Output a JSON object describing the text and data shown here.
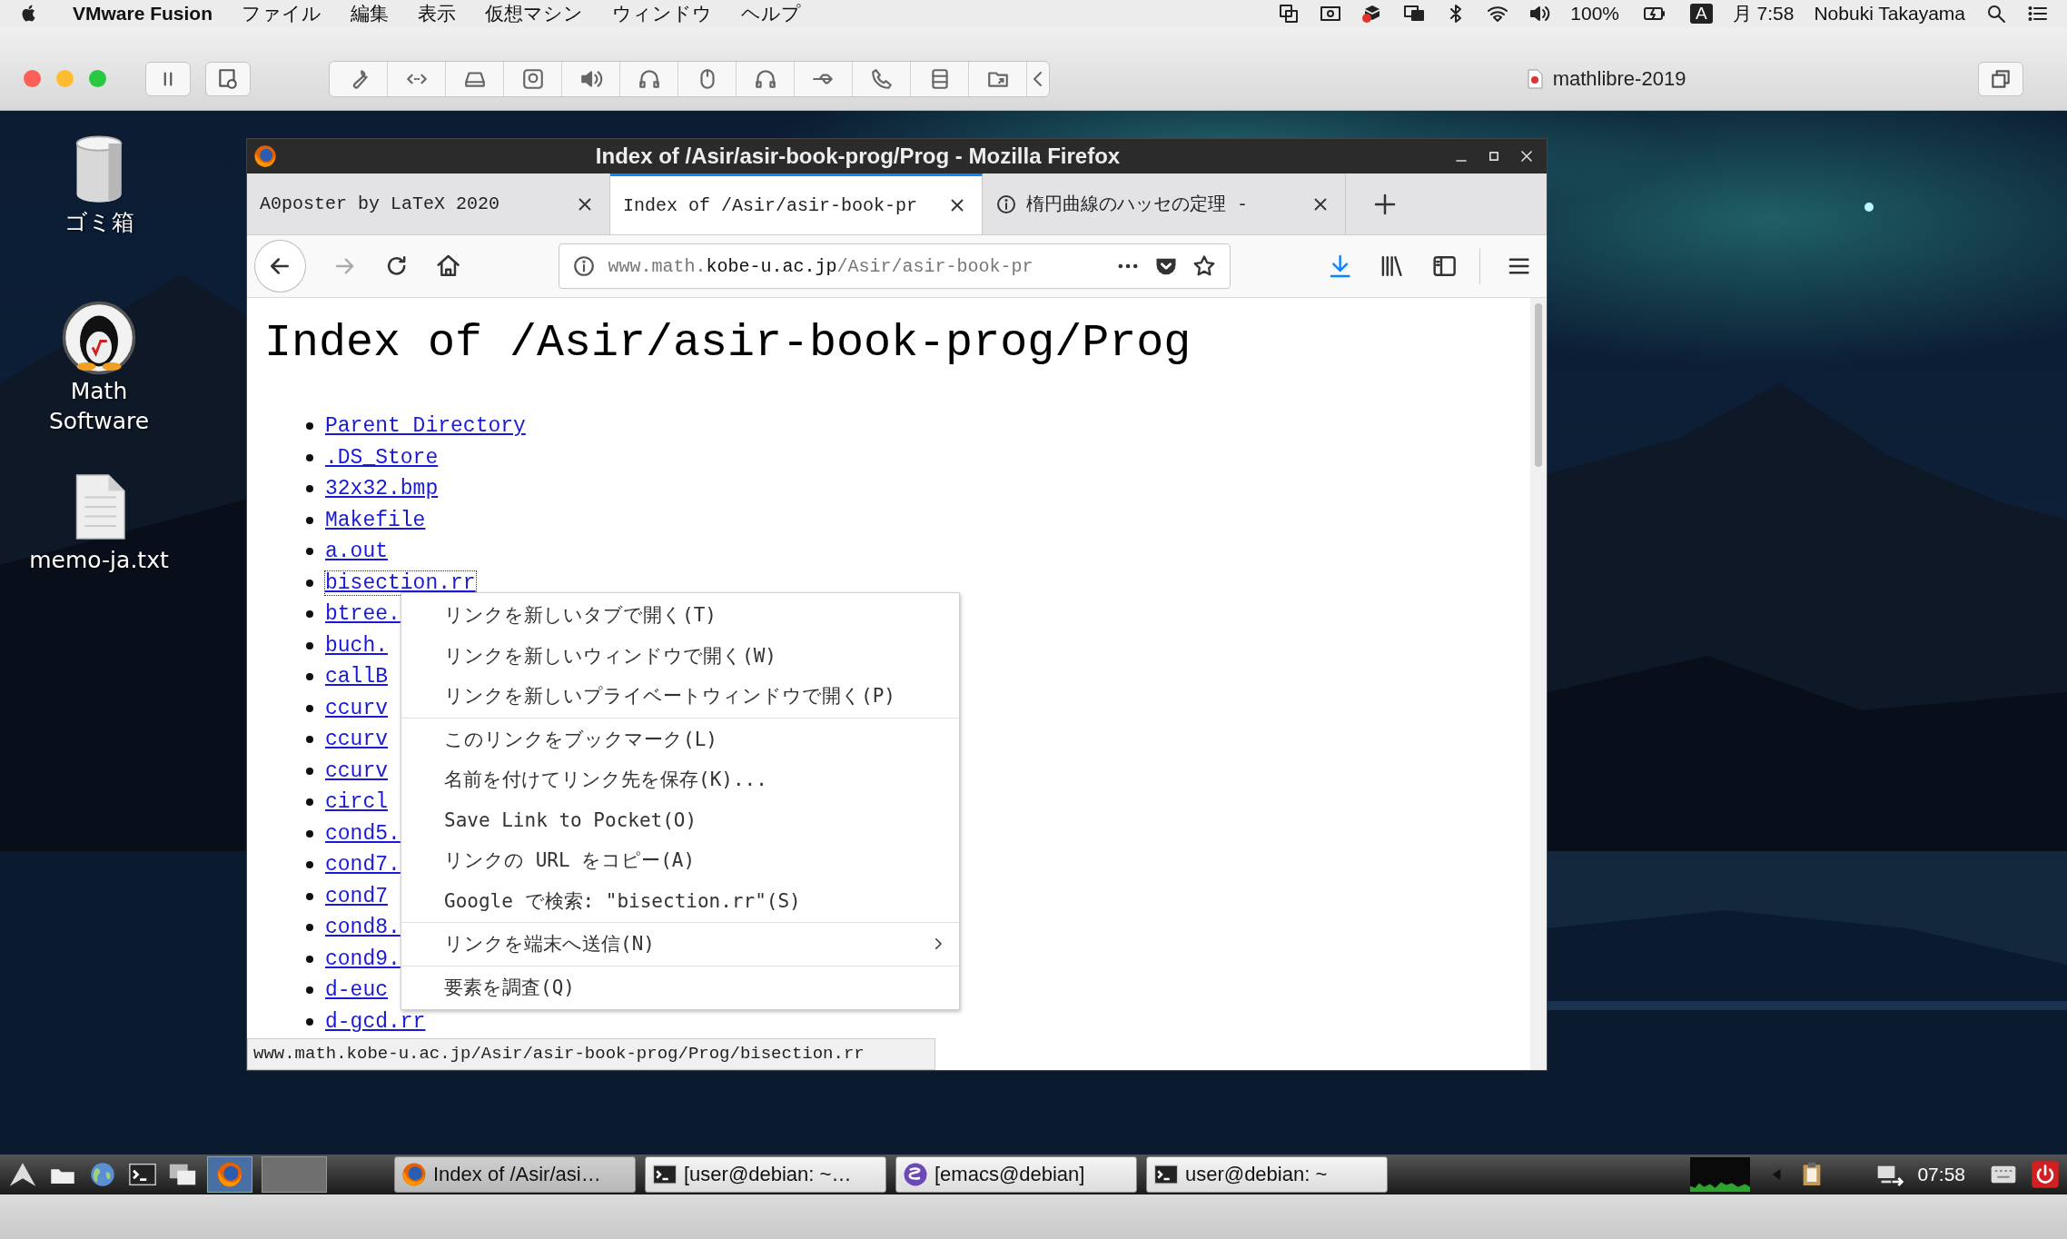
{
  "menu_bar": {
    "app": "VMware Fusion",
    "menus": [
      "ファイル",
      "編集",
      "表示",
      "仮想マシン",
      "ウィンドウ",
      "ヘルプ"
    ],
    "battery": "100%",
    "input_source": "A",
    "clock": "月 7:58",
    "user": "Nobuki Takayama"
  },
  "vm_window": {
    "title": "mathlibre-2019"
  },
  "desktop_icons": [
    {
      "label": "ゴミ箱",
      "kind": "trash"
    },
    {
      "label": "Math Software",
      "kind": "app"
    },
    {
      "label": "memo-ja.txt",
      "kind": "file"
    }
  ],
  "browser": {
    "title": "Index of /Asir/asir-book-prog/Prog - Mozilla Firefox",
    "tabs": [
      {
        "label": "A0poster by LaTeX 2020",
        "selected": false,
        "site_icon": false
      },
      {
        "label": "Index of /Asir/asir-book-pr",
        "selected": true,
        "site_icon": false
      },
      {
        "label": "楕円曲線のハッセの定理 -",
        "selected": false,
        "site_icon": true
      }
    ],
    "url": {
      "prefix": "www.math.",
      "domain": "kobe-u.ac.jp",
      "path": "/Asir/asir-book-pr"
    },
    "heading": "Index of /Asir/asir-book-prog/Prog",
    "links": [
      {
        "text": "Parent Directory",
        "focused": false
      },
      {
        "text": ".DS_Store",
        "focused": false
      },
      {
        "text": "32x32.bmp",
        "focused": false
      },
      {
        "text": "Makefile",
        "focused": false
      },
      {
        "text": "a.out",
        "focused": false
      },
      {
        "text": "bisection.rr",
        "focused": true
      },
      {
        "text": "btree.",
        "focused": false
      },
      {
        "text": "buch.",
        "focused": false
      },
      {
        "text": "callB",
        "focused": false
      },
      {
        "text": "ccurv",
        "focused": false
      },
      {
        "text": "ccurv",
        "focused": false
      },
      {
        "text": "ccurv",
        "focused": false
      },
      {
        "text": "circl",
        "focused": false
      },
      {
        "text": "cond5.",
        "focused": false
      },
      {
        "text": "cond7.",
        "focused": false
      },
      {
        "text": "cond7",
        "focused": false
      },
      {
        "text": "cond8.",
        "focused": false
      },
      {
        "text": "cond9.",
        "focused": false
      },
      {
        "text": "d-euc",
        "focused": false
      },
      {
        "text": "d-gcd.rr",
        "focused": false
      }
    ],
    "context_menu": [
      [
        {
          "label": "リンクを新しいタブで開く(T)",
          "submenu": false
        },
        {
          "label": "リンクを新しいウィンドウで開く(W)",
          "submenu": false
        },
        {
          "label": "リンクを新しいプライベートウィンドウで開く(P)",
          "submenu": false
        }
      ],
      [
        {
          "label": "このリンクをブックマーク(L)",
          "submenu": false
        },
        {
          "label": "名前を付けてリンク先を保存(K)...",
          "submenu": false
        },
        {
          "label": "Save Link to Pocket(O)",
          "submenu": false
        },
        {
          "label": "リンクの URL をコピー(A)",
          "submenu": false
        },
        {
          "label": "Google で検索: \"bisection.rr\"(S)",
          "submenu": false
        }
      ],
      [
        {
          "label": "リンクを端末へ送信(N)",
          "submenu": true
        }
      ],
      [
        {
          "label": "要素を調査(Q)",
          "submenu": false
        }
      ]
    ],
    "status": "www.math.kobe-u.ac.jp/Asir/asir-book-prog/Prog/bisection.rr"
  },
  "taskbar": {
    "tasks": [
      {
        "label": "Index of /Asir/asi…",
        "kind": "browser",
        "selected": true
      },
      {
        "label": "[user@debian: ~…",
        "kind": "terminal",
        "selected": false
      },
      {
        "label": "[emacs@debian]",
        "kind": "emacs",
        "selected": false
      },
      {
        "label": "user@debian: ~",
        "kind": "terminal",
        "selected": false
      }
    ],
    "clock": "07:58"
  }
}
